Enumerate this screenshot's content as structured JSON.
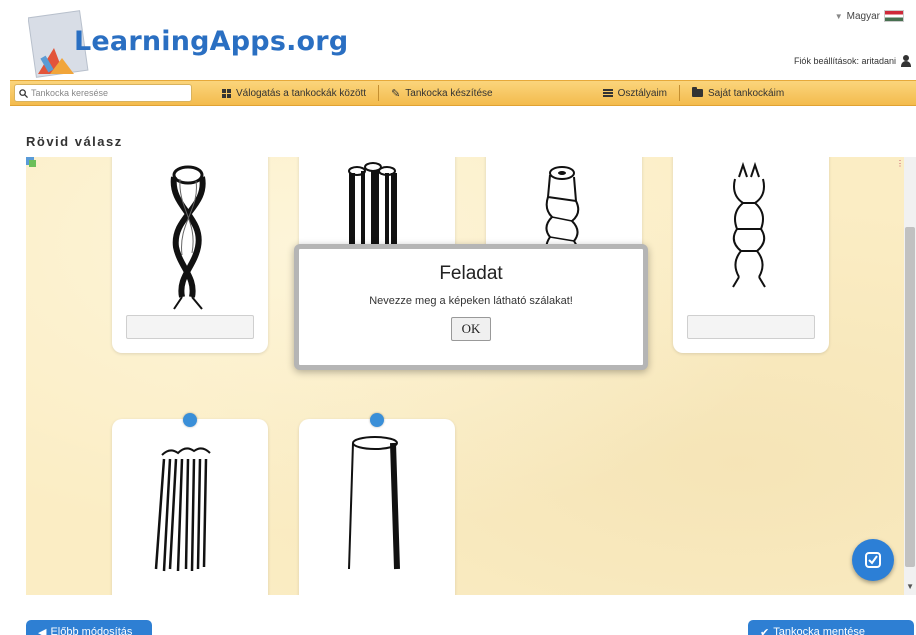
{
  "header": {
    "logo": "LearningApps.org",
    "language": "Magyar",
    "account": "Fiók beállítások: aritadani"
  },
  "nav": {
    "search_placeholder": "Tankocka keresése",
    "browse": "Válogatás a tankockák között",
    "create": "Tankocka készítése",
    "classes": "Osztályaim",
    "my_apps": "Saját tankockáim"
  },
  "page": {
    "title": "Rövid válasz"
  },
  "modal": {
    "title": "Feladat",
    "text": "Nevezze meg a képeken látható szálakat!",
    "ok": "OK"
  },
  "bottom": {
    "left_label": "Előbb módosítás",
    "right_label": "Tankocka mentése"
  },
  "colors": {
    "accent": "#2e7fd3",
    "nav_bar": "#f3bb4d",
    "app_background": "#fbedc4"
  },
  "icons": {
    "language": "flag-hungary-icon",
    "account": "user-icon",
    "browse": "grid-icon",
    "create": "pencil-icon",
    "classes": "list-icon",
    "my_apps": "folder-icon",
    "check": "check-icon"
  }
}
